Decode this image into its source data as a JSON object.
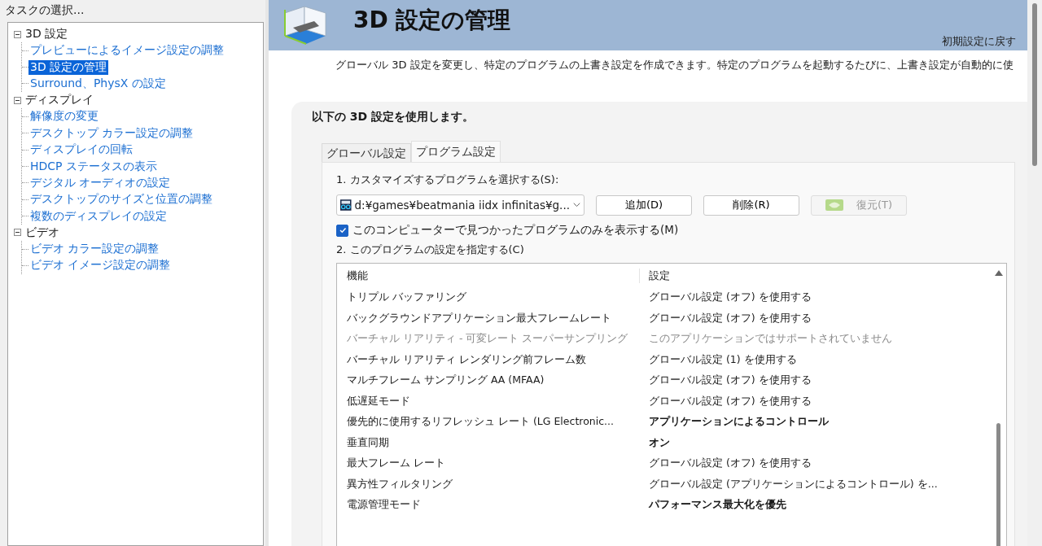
{
  "sidebar": {
    "title": "タスクの選択...",
    "tree": [
      {
        "label": "3D 設定",
        "expanded": true,
        "selected": false,
        "children": [
          {
            "label": "プレビューによるイメージ設定の調整",
            "selected": false
          },
          {
            "label": "3D 設定の管理",
            "selected": true
          },
          {
            "label": "Surround、PhysX の設定",
            "selected": false
          }
        ]
      },
      {
        "label": "ディスプレイ",
        "expanded": true,
        "selected": false,
        "children": [
          {
            "label": "解像度の変更",
            "selected": false
          },
          {
            "label": "デスクトップ カラー設定の調整",
            "selected": false
          },
          {
            "label": "ディスプレイの回転",
            "selected": false
          },
          {
            "label": "HDCP ステータスの表示",
            "selected": false
          },
          {
            "label": "デジタル オーディオの設定",
            "selected": false
          },
          {
            "label": "デスクトップのサイズと位置の調整",
            "selected": false
          },
          {
            "label": "複数のディスプレイの設定",
            "selected": false
          }
        ]
      },
      {
        "label": "ビデオ",
        "expanded": true,
        "selected": false,
        "children": [
          {
            "label": "ビデオ カラー設定の調整",
            "selected": false
          },
          {
            "label": "ビデオ イメージ設定の調整",
            "selected": false
          }
        ]
      }
    ]
  },
  "page": {
    "title": "3D 設定の管理",
    "restore_link": "初期設定に戻す",
    "description": "グローバル 3D 設定を変更し、特定のプログラムの上書き設定を作成できます。特定のプログラムを起動するたびに、上書き設定が自動的に使"
  },
  "panel": {
    "heading": "以下の 3D 設定を使用します。",
    "tabs": [
      {
        "label": "グローバル設定",
        "selected": false
      },
      {
        "label": "プログラム設定",
        "selected": true
      }
    ],
    "step1_label": "1. カスタマイズするプログラムを選択する(S):",
    "program_select": {
      "value": "d:¥games¥beatmania iidx infinitas¥g..."
    },
    "buttons": [
      {
        "label": "追加(D)",
        "disabled": false,
        "kind": "plain"
      },
      {
        "label": "削除(R)",
        "disabled": false,
        "kind": "plain"
      },
      {
        "label": "復元(T)",
        "disabled": true,
        "kind": "restore"
      }
    ],
    "show_found_only": {
      "label": "このコンピューターで見つかったプログラムのみを表示する(M)",
      "checked": true
    },
    "step2_label": "2. このプログラムの設定を指定する(C)",
    "table": {
      "columns": [
        "機能",
        "設定"
      ],
      "rows": [
        {
          "feature": "トリプル バッファリング",
          "setting": "グローバル設定 (オフ) を使用する",
          "disabled": false,
          "overridden": false
        },
        {
          "feature": "バックグラウンドアプリケーション最大フレームレート",
          "setting": "グローバル設定 (オフ) を使用する",
          "disabled": false,
          "overridden": false
        },
        {
          "feature": "バーチャル リアリティ - 可変レート スーパーサンプリング",
          "setting": "このアプリケーションではサポートされていません",
          "disabled": true,
          "overridden": false
        },
        {
          "feature": "バーチャル リアリティ レンダリング前フレーム数",
          "setting": "グローバル設定 (1) を使用する",
          "disabled": false,
          "overridden": false
        },
        {
          "feature": "マルチフレーム サンプリング AA (MFAA)",
          "setting": "グローバル設定 (オフ) を使用する",
          "disabled": false,
          "overridden": false
        },
        {
          "feature": "低遅延モード",
          "setting": "グローバル設定 (オフ) を使用する",
          "disabled": false,
          "overridden": false
        },
        {
          "feature": "優先的に使用するリフレッシュ レート (LG Electronic...",
          "setting": "アプリケーションによるコントロール",
          "disabled": false,
          "overridden": true
        },
        {
          "feature": "垂直同期",
          "setting": "オン",
          "disabled": false,
          "overridden": true
        },
        {
          "feature": "最大フレーム レート",
          "setting": "グローバル設定 (オフ) を使用する",
          "disabled": false,
          "overridden": false
        },
        {
          "feature": "異方性フィルタリング",
          "setting": "グローバル設定 (アプリケーションによるコントロール) を...",
          "disabled": false,
          "overridden": false
        },
        {
          "feature": "電源管理モード",
          "setting": "パフォーマンス最大化を優先",
          "disabled": false,
          "overridden": true
        }
      ]
    }
  }
}
